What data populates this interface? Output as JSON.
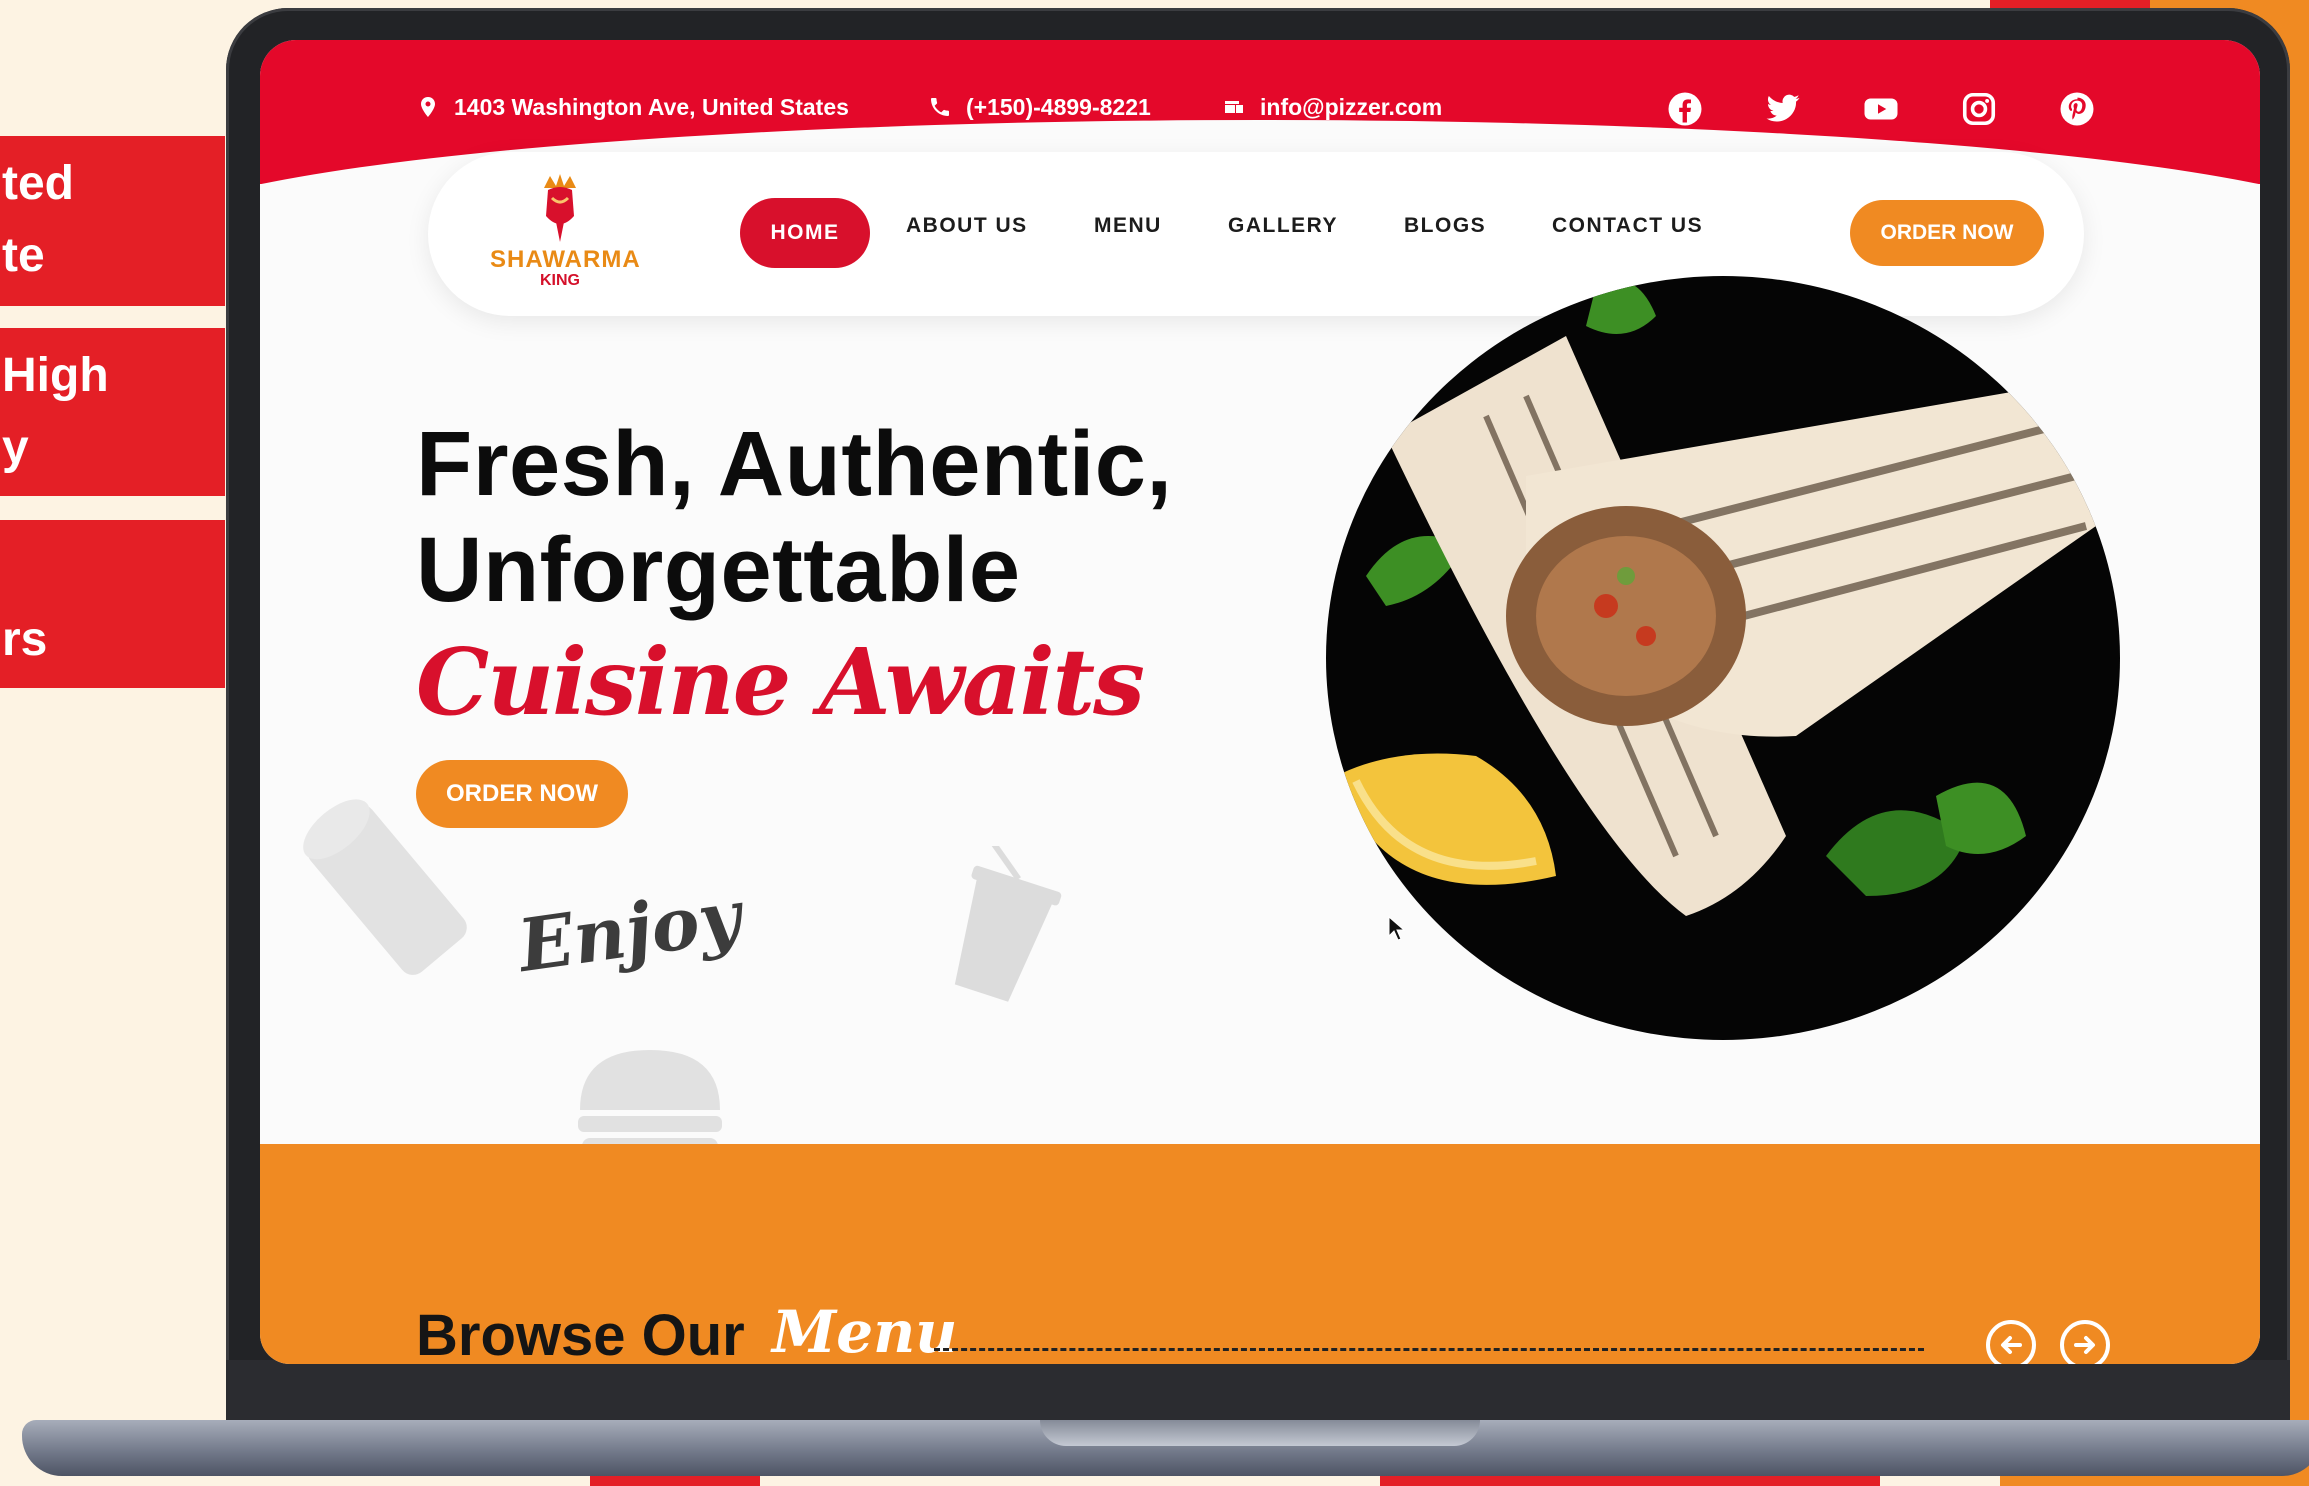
{
  "side_cards": [
    {
      "lines": [
        "ted",
        "te"
      ]
    },
    {
      "lines": [
        "High",
        "y"
      ]
    },
    {
      "lines": [
        "",
        "rs"
      ]
    }
  ],
  "topbar": {
    "address": "1403 Washington Ave, United States",
    "phone": "(+150)-4899-8221",
    "email": "info@pizzer.com",
    "social": [
      "facebook-icon",
      "twitter-icon",
      "youtube-icon",
      "instagram-icon",
      "pinterest-icon"
    ]
  },
  "logo": {
    "line1": "SHAWARMA",
    "line2": "KING"
  },
  "nav": {
    "home": "HOME",
    "about": "ABOUT US",
    "menu": "MENU",
    "gallery": "GALLERY",
    "blogs": "BLOGS",
    "contact": "CONTACT US",
    "order": "ORDER NOW"
  },
  "hero": {
    "line1": "Fresh, Authentic,",
    "line2": "Unforgettable",
    "line3": "Cuisine Awaits",
    "cta": "ORDER NOW",
    "enjoy": "Enjoy"
  },
  "section": {
    "title_black": "Browse Our",
    "title_white": "Menu"
  },
  "colors": {
    "brand_red": "#e4082a",
    "brand_orange": "#f08a22",
    "background": "#fbfbfb"
  }
}
